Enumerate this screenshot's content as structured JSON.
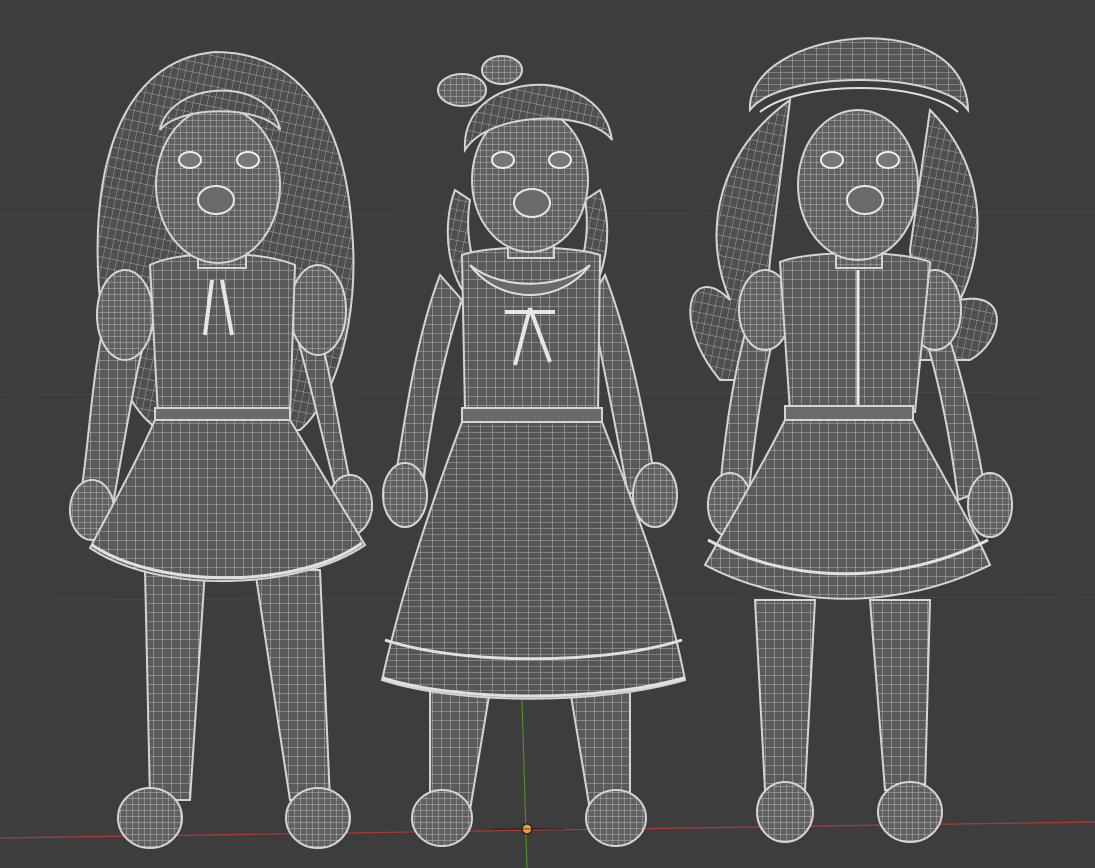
{
  "viewport": {
    "mode": "wireframe",
    "background_color": "#3d3d3d",
    "wire_color": "#d0d0d0",
    "x_axis_color": "#b03838",
    "y_axis_color": "#4e8a2a",
    "origin_color": "#f0a040"
  },
  "models": [
    {
      "name": "doll-long-hair",
      "hair": "long-loose",
      "skirt": "short"
    },
    {
      "name": "doll-braids-bow",
      "hair": "braids-with-bow",
      "skirt": "long"
    },
    {
      "name": "doll-bonnet",
      "hair": "long-curled-with-bonnet",
      "skirt": "short"
    }
  ]
}
